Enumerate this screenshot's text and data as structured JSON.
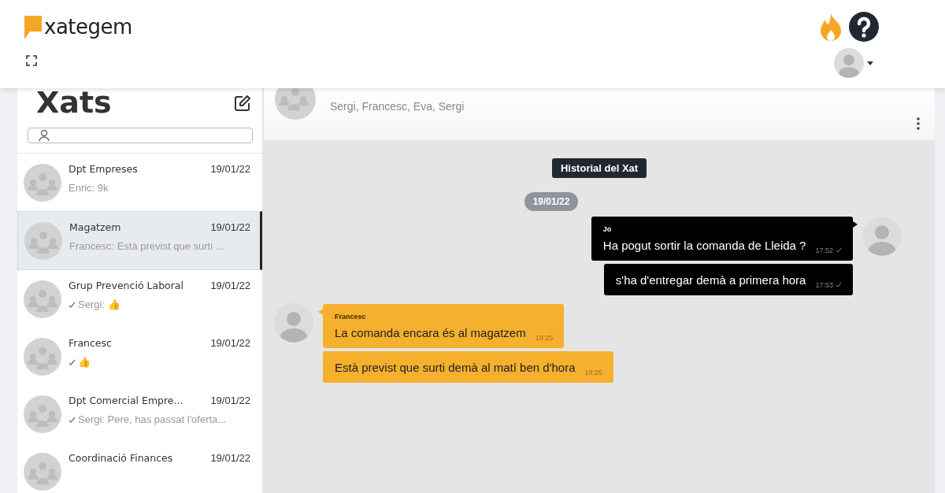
{
  "app": {
    "logo": "xategem"
  },
  "sidebar": {
    "title": "Xats",
    "chats": [
      {
        "name": "Dpt Empreses",
        "date": "19/01/22",
        "preview": "Enric: 9k",
        "ticked": false,
        "selected": false
      },
      {
        "name": "Magatzem",
        "date": "19/01/22",
        "preview": "Francesc: Està previst que surti ...",
        "ticked": false,
        "selected": true
      },
      {
        "name": "Grup Prevenció Laboral",
        "date": "19/01/22",
        "preview": "Sergi: 👍",
        "ticked": true,
        "selected": false
      },
      {
        "name": "Francesc",
        "date": "19/01/22",
        "preview": "👍",
        "ticked": true,
        "selected": false
      },
      {
        "name": "Dpt Comercial Empre...",
        "date": "19/01/22",
        "preview": "Sergi: Pere, has passat l'oferta...",
        "ticked": true,
        "selected": false
      },
      {
        "name": "Coordinació Finances",
        "date": "19/01/22",
        "ticked": false,
        "selected": false
      }
    ]
  },
  "chat": {
    "members": "Sergi, Francesc, Eva, Sergi",
    "history_label": "Historial del Xat",
    "date": "19/01/22",
    "messages": [
      {
        "kind": "out",
        "sender": "Jo",
        "text": "Ha pogut sortir la comanda de Lleida ?",
        "time": "17:52",
        "read": true
      },
      {
        "kind": "out",
        "text": "s'ha d'entregar demà a primera hora",
        "time": "17:53",
        "read": true
      },
      {
        "kind": "in",
        "sender": "Francesc",
        "text": "La comanda encara és al magatzem",
        "time": "18:25",
        "read": false
      },
      {
        "kind": "in",
        "text": "Està previst que surti demà al matí ben d'hora",
        "time": "18:25",
        "read": false
      }
    ]
  }
}
